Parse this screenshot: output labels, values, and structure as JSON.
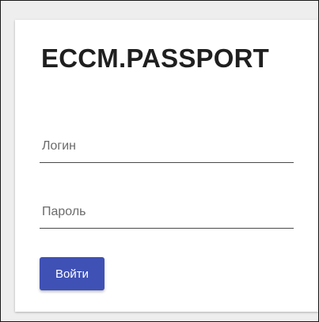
{
  "login_form": {
    "title": "ECCM.PASSPORT",
    "login_field": {
      "placeholder": "Логин",
      "value": ""
    },
    "password_field": {
      "placeholder": "Пароль",
      "value": ""
    },
    "submit_label": "Войти"
  },
  "colors": {
    "page_background": "#eeeeee",
    "card_background": "#ffffff",
    "accent": "#3f51b5",
    "title_text": "#1f1f1f",
    "field_underline": "#4a4a4a"
  }
}
